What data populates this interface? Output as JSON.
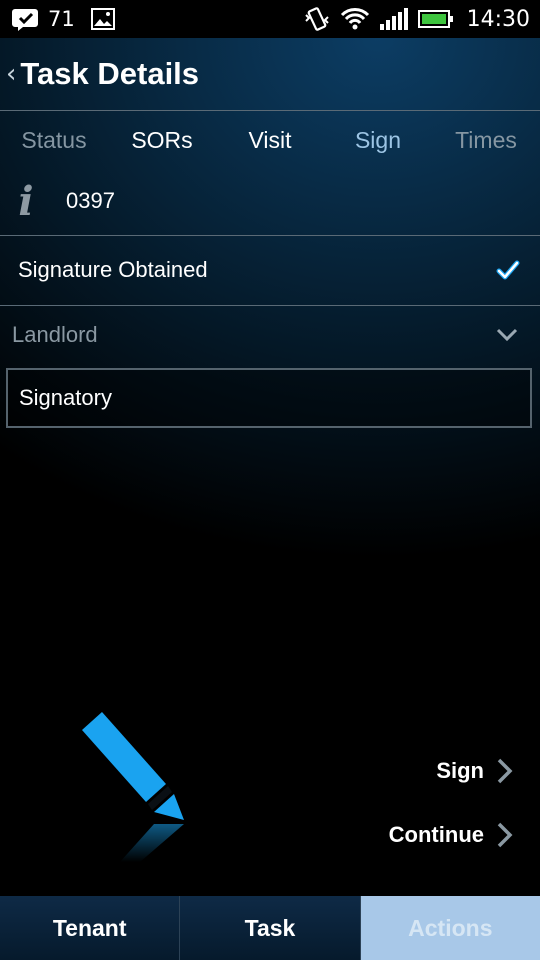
{
  "status_bar": {
    "notification_count": "71",
    "time": "14:30",
    "icons": [
      "check-bubble-icon",
      "image-icon",
      "vibrate-icon",
      "wifi-icon",
      "signal-icon",
      "battery-icon"
    ]
  },
  "header": {
    "back_chevron": "‹",
    "title": "Task Details"
  },
  "tabs": [
    {
      "label": "Status"
    },
    {
      "label": "SORs"
    },
    {
      "label": "Visit"
    },
    {
      "label": "Sign"
    },
    {
      "label": "Times"
    }
  ],
  "info": {
    "icon_glyph": "i",
    "value": "0397"
  },
  "signature": {
    "label": "Signature Obtained",
    "checked": true
  },
  "party": {
    "selected": "Landlord"
  },
  "signatory": {
    "value": "Signatory"
  },
  "actions": {
    "sign_label": "Sign",
    "continue_label": "Continue"
  },
  "bottom_nav": [
    {
      "label": "Tenant"
    },
    {
      "label": "Task"
    },
    {
      "label": "Actions"
    }
  ],
  "colors": {
    "accent_blue": "#1aa3f0",
    "active_tab": "#9cc4e4",
    "active_bottom": "#a8c8e8"
  }
}
